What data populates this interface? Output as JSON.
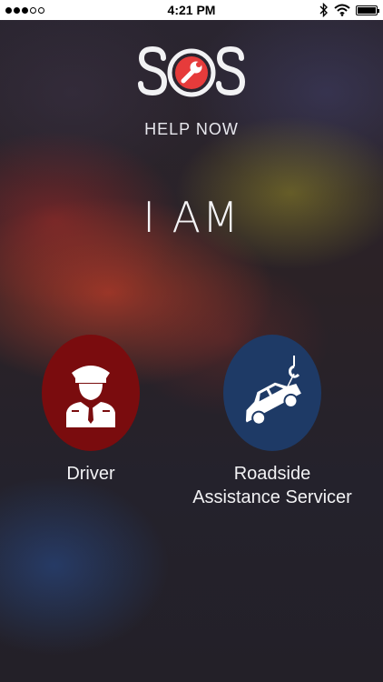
{
  "status_bar": {
    "carrier_dots": [
      true,
      true,
      true,
      false,
      false
    ],
    "time": "4:21 PM",
    "icons": [
      "bluetooth-icon",
      "wifi-icon",
      "battery-icon"
    ],
    "battery_level": 1.0
  },
  "brand": {
    "logo_text": "SOS",
    "logo_icon": "wrench-icon",
    "tagline": "HELP NOW",
    "accent_color": "#e63b3b"
  },
  "prompt": "I AM",
  "roles": [
    {
      "label": "Driver",
      "icon": "driver-icon",
      "color": "#7a0c0e"
    },
    {
      "label_line1": "Roadside",
      "label_line2": "Assistance Servicer",
      "icon": "tow-car-icon",
      "color": "#1e3a66"
    }
  ]
}
